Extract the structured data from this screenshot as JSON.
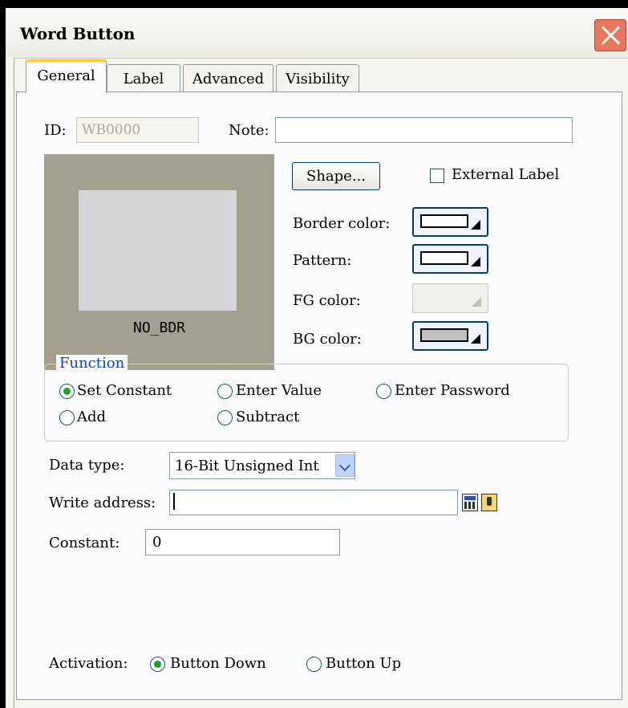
{
  "window": {
    "title": "Word Button"
  },
  "tabs": [
    {
      "label": "General"
    },
    {
      "label": "Label"
    },
    {
      "label": "Advanced"
    },
    {
      "label": "Visibility"
    }
  ],
  "general": {
    "id_label": "ID:",
    "id_value": "WB0000",
    "note_label": "Note:",
    "note_value": "",
    "preview_label": "NO_BDR",
    "shape_button": "Shape...",
    "external_label": {
      "label": "External Label",
      "checked": false
    },
    "border_color_label": "Border color:",
    "pattern_label": "Pattern:",
    "fg_color_label": "FG color:",
    "bg_color_label": "BG color:",
    "colors": {
      "border": "#ffffff",
      "pattern": "#ffffff",
      "bg": "#c0c0c0"
    }
  },
  "function": {
    "legend": "Function",
    "options": [
      {
        "label": "Set Constant",
        "selected": true
      },
      {
        "label": "Enter Value",
        "selected": false
      },
      {
        "label": "Enter Password",
        "selected": false
      },
      {
        "label": "Add",
        "selected": false
      },
      {
        "label": "Subtract",
        "selected": false
      }
    ]
  },
  "data_type": {
    "label": "Data type:",
    "value": "16-Bit Unsigned Int"
  },
  "write_address": {
    "label": "Write address:",
    "value": ""
  },
  "constant": {
    "label": "Constant:",
    "value": "0"
  },
  "activation": {
    "label": "Activation:",
    "options": [
      {
        "label": "Button Down",
        "selected": true
      },
      {
        "label": "Button Up",
        "selected": false
      }
    ]
  }
}
